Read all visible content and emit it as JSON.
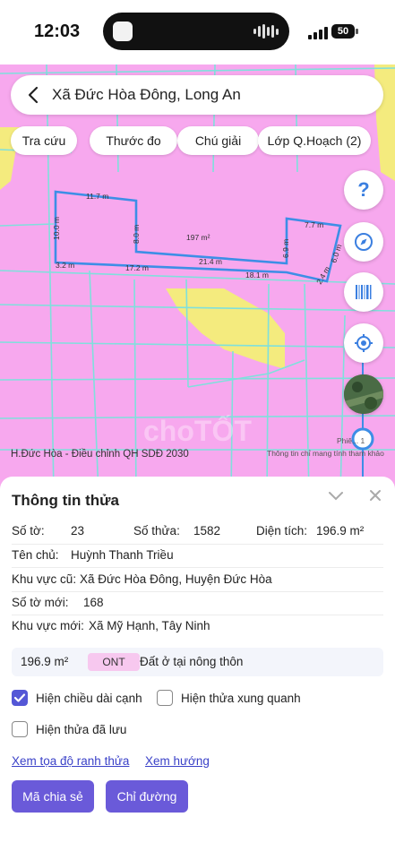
{
  "status_bar": {
    "time": "12:03",
    "battery": "50"
  },
  "search": {
    "text": "Xã Đức Hòa Đông, Long An"
  },
  "chips": [
    {
      "label": "Tra cứu"
    },
    {
      "label": "Thước đo"
    },
    {
      "label": "Chú giải"
    },
    {
      "label": "Lớp Q.Hoạch (2)"
    }
  ],
  "map": {
    "edges": [
      "11.7 m",
      "10.0 m",
      "8.0 m",
      "197 m²",
      "7.7 m",
      "6.9 m",
      "6.0 m",
      "21.4 m",
      "3.2 m",
      "17.2 m",
      "18.1 m",
      "2.4 m"
    ],
    "help_label": "?",
    "footer_left": "H.Đức Hòa - Điều chỉnh QH SDĐ 2030",
    "footer_right": "Thông tin chỉ mang tính tham khảo",
    "phieu": "Phiê... 1",
    "watermark": "choTỐT",
    "colors": {
      "base": "#f7a8ee",
      "yellow": "#f4eb7e",
      "parcel": "#3d8ee6",
      "roads": "#7fe0dc"
    }
  },
  "panel": {
    "title": "Thông tin thửa",
    "so_to_label": "Số tờ:",
    "so_to_value": "23",
    "so_thua_label": "Số thửa:",
    "so_thua_value": "1582",
    "dien_tich_label": "Diện tích:",
    "dien_tich_value": "196.9 m²",
    "ten_chu_label": "Tên chủ:",
    "ten_chu_value": "Huỳnh Thanh Triều",
    "khu_vuc_cu_label": "Khu vực cũ:",
    "khu_vuc_cu_value": "Xã Đức Hòa Đông, Huyện Đức Hòa",
    "so_to_moi_label": "Số tờ mới:",
    "so_to_moi_value": "168",
    "khu_vuc_moi_label": "Khu vực mới:",
    "khu_vuc_moi_value": "Xã Mỹ Hạnh, Tây Ninh",
    "summary_area": "196.9 m²",
    "summary_code": "ONT",
    "summary_type": "Đất ở tại nông thôn",
    "check_edges_label": "Hiện chiều dài cạnh",
    "check_edges_checked": true,
    "check_neighbors_label": "Hiện thửa xung quanh",
    "check_neighbors_checked": false,
    "check_saved_label": "Hiện thửa đã lưu",
    "check_saved_checked": false,
    "link_coords": "Xem tọa độ ranh thửa",
    "link_direction": "Xem hướng",
    "btn_share": "Mã chia sẻ",
    "btn_route": "Chỉ đường"
  }
}
